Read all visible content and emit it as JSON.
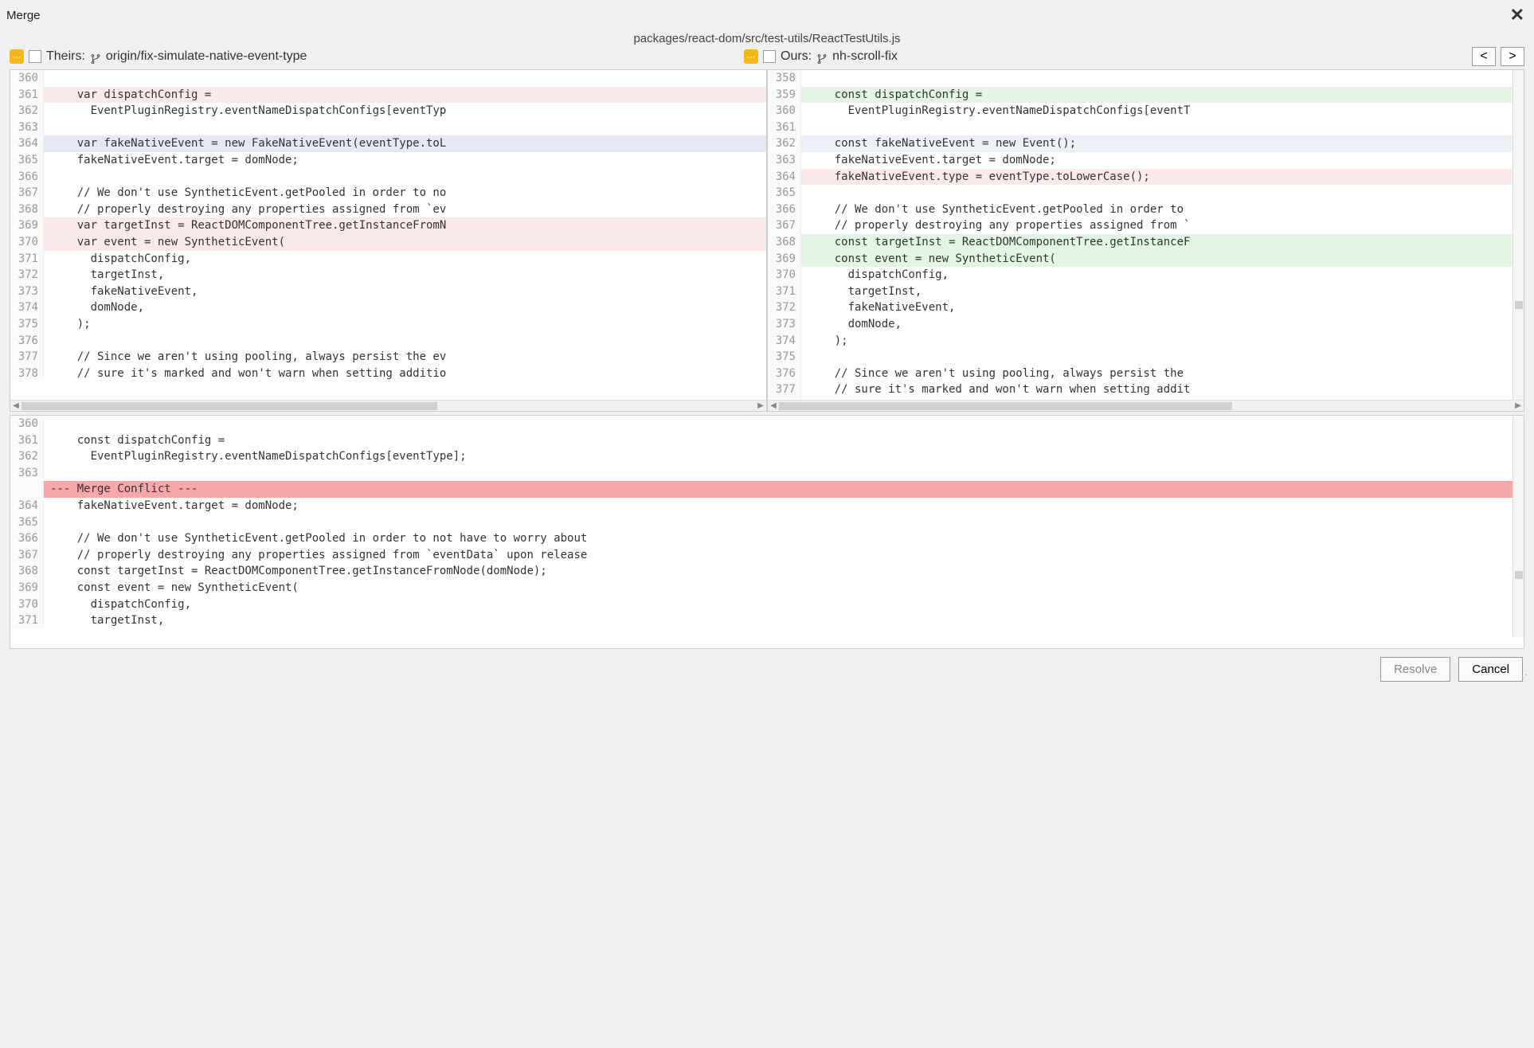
{
  "window": {
    "title": "Merge"
  },
  "file_path": "packages/react-dom/src/test-utils/ReactTestUtils.js",
  "theirs": {
    "label": "Theirs:",
    "branch": "origin/fix-simulate-native-event-type"
  },
  "ours": {
    "label": "Ours:",
    "branch": "nh-scroll-fix"
  },
  "nav": {
    "prev": "<",
    "next": ">"
  },
  "theirs_lines": [
    {
      "n": "360",
      "t": "",
      "hl": ""
    },
    {
      "n": "361",
      "t": "    var dispatchConfig =",
      "hl": "hl-lightred"
    },
    {
      "n": "362",
      "t": "      EventPluginRegistry.eventNameDispatchConfigs[eventTyp",
      "hl": ""
    },
    {
      "n": "363",
      "t": "",
      "hl": ""
    },
    {
      "n": "364",
      "t": "    var fakeNativeEvent = new FakeNativeEvent(eventType.toL",
      "hl": "hl-blue"
    },
    {
      "n": "365",
      "t": "    fakeNativeEvent.target = domNode;",
      "hl": ""
    },
    {
      "n": "",
      "t": "",
      "hl": "hl-yellow"
    },
    {
      "n": "366",
      "t": "",
      "hl": ""
    },
    {
      "n": "367",
      "t": "    // We don't use SyntheticEvent.getPooled in order to no",
      "hl": ""
    },
    {
      "n": "368",
      "t": "    // properly destroying any properties assigned from `ev",
      "hl": ""
    },
    {
      "n": "369",
      "t": "    var targetInst = ReactDOMComponentTree.getInstanceFromN",
      "hl": "hl-lightred"
    },
    {
      "n": "370",
      "t": "    var event = new SyntheticEvent(",
      "hl": "hl-lightred"
    },
    {
      "n": "371",
      "t": "      dispatchConfig,",
      "hl": ""
    },
    {
      "n": "372",
      "t": "      targetInst,",
      "hl": ""
    },
    {
      "n": "373",
      "t": "      fakeNativeEvent,",
      "hl": ""
    },
    {
      "n": "374",
      "t": "      domNode,",
      "hl": ""
    },
    {
      "n": "375",
      "t": "    );",
      "hl": ""
    },
    {
      "n": "376",
      "t": "",
      "hl": ""
    },
    {
      "n": "377",
      "t": "    // Since we aren't using pooling, always persist the ev",
      "hl": ""
    },
    {
      "n": "378",
      "t": "    // sure it's marked and won't warn when setting additio",
      "hl": ""
    }
  ],
  "ours_lines": [
    {
      "n": "358",
      "t": "",
      "hl": ""
    },
    {
      "n": "359",
      "t": "    const dispatchConfig =",
      "hl": "hl-green"
    },
    {
      "n": "360",
      "t": "      EventPluginRegistry.eventNameDispatchConfigs[eventT",
      "hl": ""
    },
    {
      "n": "361",
      "t": "",
      "hl": ""
    },
    {
      "n": "362",
      "t": "    const fakeNativeEvent = new Event();",
      "hl": "hl-lightblue"
    },
    {
      "n": "363",
      "t": "    fakeNativeEvent.target = domNode;",
      "hl": ""
    },
    {
      "n": "364",
      "t": "    fakeNativeEvent.type = eventType.toLowerCase();",
      "hl": "hl-lightred"
    },
    {
      "n": "365",
      "t": "",
      "hl": ""
    },
    {
      "n": "366",
      "t": "    // We don't use SyntheticEvent.getPooled in order to ",
      "hl": ""
    },
    {
      "n": "367",
      "t": "    // properly destroying any properties assigned from `",
      "hl": ""
    },
    {
      "n": "368",
      "t": "    const targetInst = ReactDOMComponentTree.getInstanceF",
      "hl": "hl-green"
    },
    {
      "n": "369",
      "t": "    const event = new SyntheticEvent(",
      "hl": "hl-green"
    },
    {
      "n": "370",
      "t": "      dispatchConfig,",
      "hl": ""
    },
    {
      "n": "371",
      "t": "      targetInst,",
      "hl": ""
    },
    {
      "n": "372",
      "t": "      fakeNativeEvent,",
      "hl": ""
    },
    {
      "n": "373",
      "t": "      domNode,",
      "hl": ""
    },
    {
      "n": "374",
      "t": "    );",
      "hl": ""
    },
    {
      "n": "375",
      "t": "",
      "hl": ""
    },
    {
      "n": "376",
      "t": "    // Since we aren't using pooling, always persist the ",
      "hl": ""
    },
    {
      "n": "377",
      "t": "    // sure it's marked and won't warn when setting addit",
      "hl": ""
    }
  ],
  "merge_lines": [
    {
      "n": "360",
      "t": "",
      "hl": ""
    },
    {
      "n": "361",
      "t": "    const dispatchConfig =",
      "hl": ""
    },
    {
      "n": "362",
      "t": "      EventPluginRegistry.eventNameDispatchConfigs[eventType];",
      "hl": ""
    },
    {
      "n": "363",
      "t": "",
      "hl": ""
    },
    {
      "n": "",
      "t": "--- Merge Conflict ---",
      "hl": "conflict-bar"
    },
    {
      "n": "364",
      "t": "    fakeNativeEvent.target = domNode;",
      "hl": ""
    },
    {
      "n": "",
      "t": "",
      "hl": "hl-yellow"
    },
    {
      "n": "365",
      "t": "",
      "hl": ""
    },
    {
      "n": "366",
      "t": "    // We don't use SyntheticEvent.getPooled in order to not have to worry about",
      "hl": ""
    },
    {
      "n": "367",
      "t": "    // properly destroying any properties assigned from `eventData` upon release",
      "hl": ""
    },
    {
      "n": "368",
      "t": "    const targetInst = ReactDOMComponentTree.getInstanceFromNode(domNode);",
      "hl": ""
    },
    {
      "n": "369",
      "t": "    const event = new SyntheticEvent(",
      "hl": ""
    },
    {
      "n": "370",
      "t": "      dispatchConfig,",
      "hl": ""
    },
    {
      "n": "371",
      "t": "      targetInst,",
      "hl": ""
    }
  ],
  "footer": {
    "resolve": "Resolve",
    "cancel": "Cancel"
  }
}
